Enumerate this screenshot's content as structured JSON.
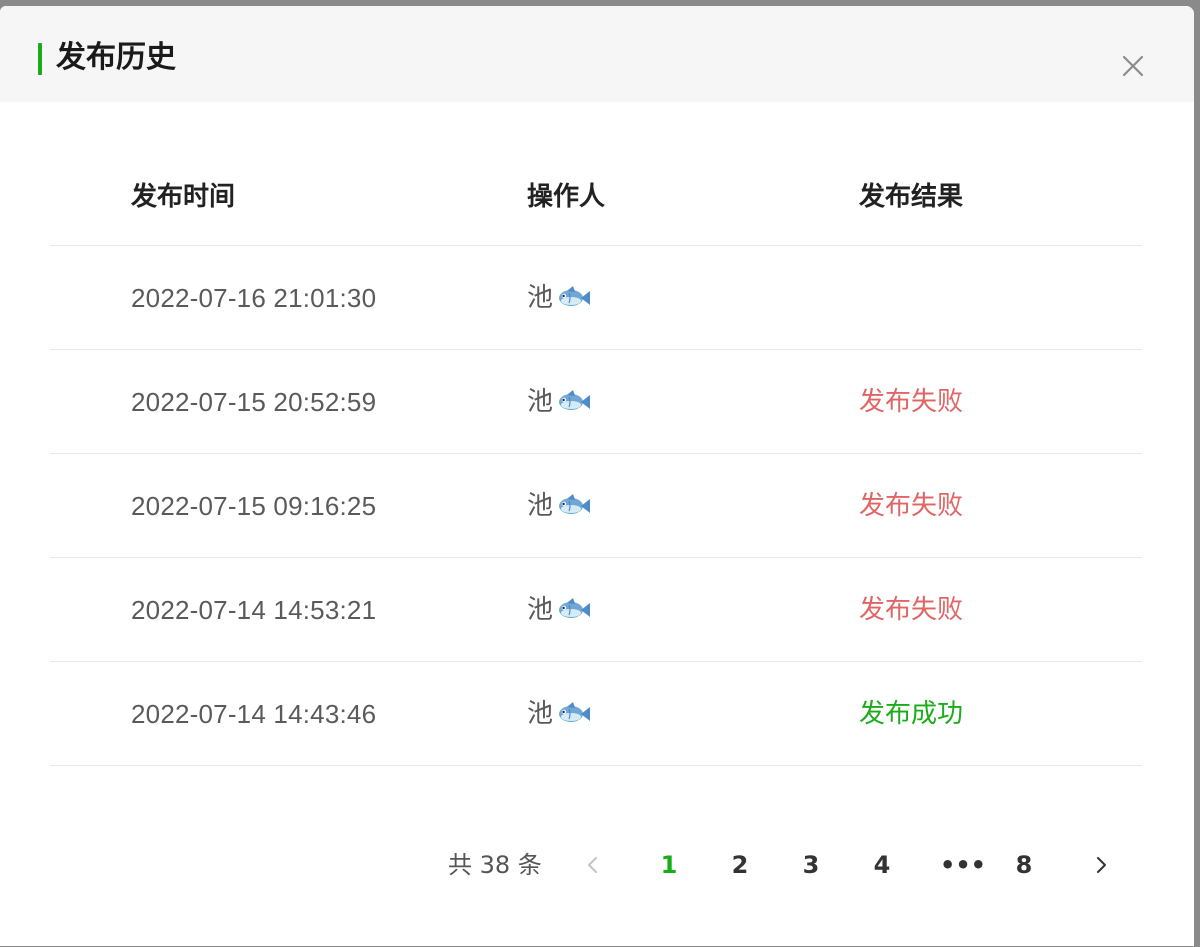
{
  "dialog": {
    "title": "发布历史",
    "accent_color": "#1aad19",
    "close_icon": "close-icon"
  },
  "table": {
    "headers": {
      "time": "发布时间",
      "operator": "操作人",
      "result": "发布结果"
    },
    "rows": [
      {
        "time": "2022-07-16 21:01:30",
        "operator": "池",
        "operator_emoji": "fish-icon",
        "result": "",
        "status": "none"
      },
      {
        "time": "2022-07-15 20:52:59",
        "operator": "池",
        "operator_emoji": "fish-icon",
        "result": "发布失败",
        "status": "fail"
      },
      {
        "time": "2022-07-15 09:16:25",
        "operator": "池",
        "operator_emoji": "fish-icon",
        "result": "发布失败",
        "status": "fail"
      },
      {
        "time": "2022-07-14 14:53:21",
        "operator": "池",
        "operator_emoji": "fish-icon",
        "result": "发布失败",
        "status": "fail"
      },
      {
        "time": "2022-07-14 14:43:46",
        "operator": "池",
        "operator_emoji": "fish-icon",
        "result": "发布成功",
        "status": "success"
      }
    ],
    "status_colors": {
      "fail": "#e16565",
      "success": "#1aad19"
    }
  },
  "pagination": {
    "total_label": "共 38 条",
    "pages": [
      "1",
      "2",
      "3",
      "4",
      "•••",
      "8"
    ],
    "current": "1",
    "prev_icon": "chevron-left-icon",
    "next_icon": "chevron-right-icon"
  }
}
